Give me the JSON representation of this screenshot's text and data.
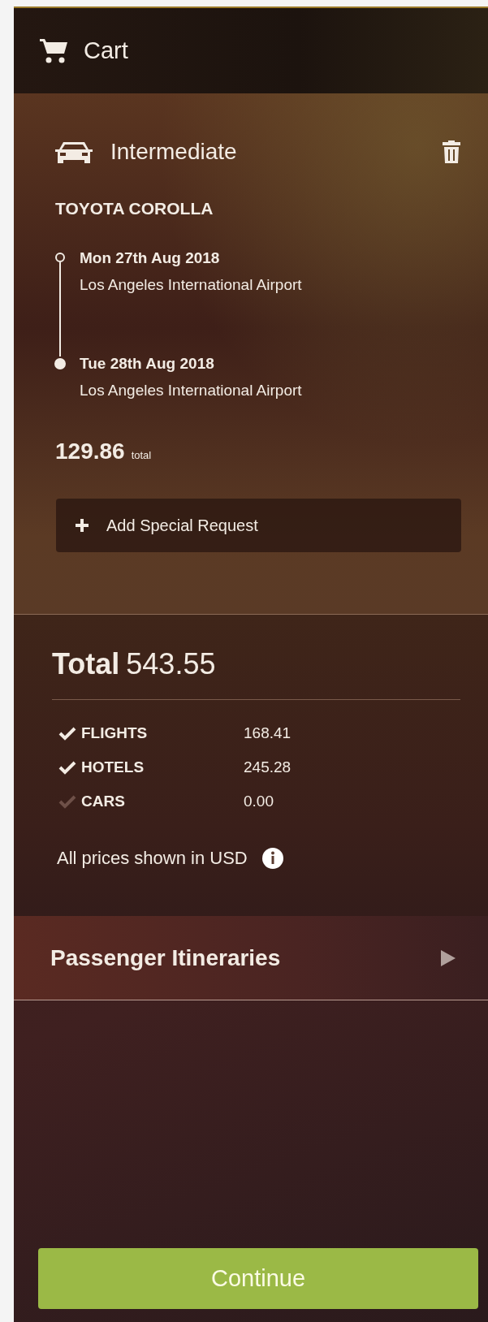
{
  "header": {
    "title": "Cart"
  },
  "car_item": {
    "category": "Intermediate",
    "model": "TOYOTA COROLLA",
    "stops": [
      {
        "kind": "pickup",
        "date": "Mon 27th Aug 2018",
        "location": "Los Angeles International Airport"
      },
      {
        "kind": "dropoff",
        "date": "Tue 28th Aug 2018",
        "location": "Los Angeles International Airport"
      }
    ],
    "price": "129.86",
    "price_suffix": "total",
    "special_request_button": "Add Special Request"
  },
  "summary": {
    "total_label": "Total",
    "total_value": "543.55",
    "breakdown": [
      {
        "label": "FLIGHTS",
        "amount": "168.41",
        "included": true
      },
      {
        "label": "HOTELS",
        "amount": "245.28",
        "included": true
      },
      {
        "label": "CARS",
        "amount": "0.00",
        "included": false
      }
    ],
    "currency_note": "All prices shown in USD"
  },
  "passenger_itineraries": {
    "label": "Passenger Itineraries",
    "expanded": false
  },
  "continue_button": "Continue"
}
